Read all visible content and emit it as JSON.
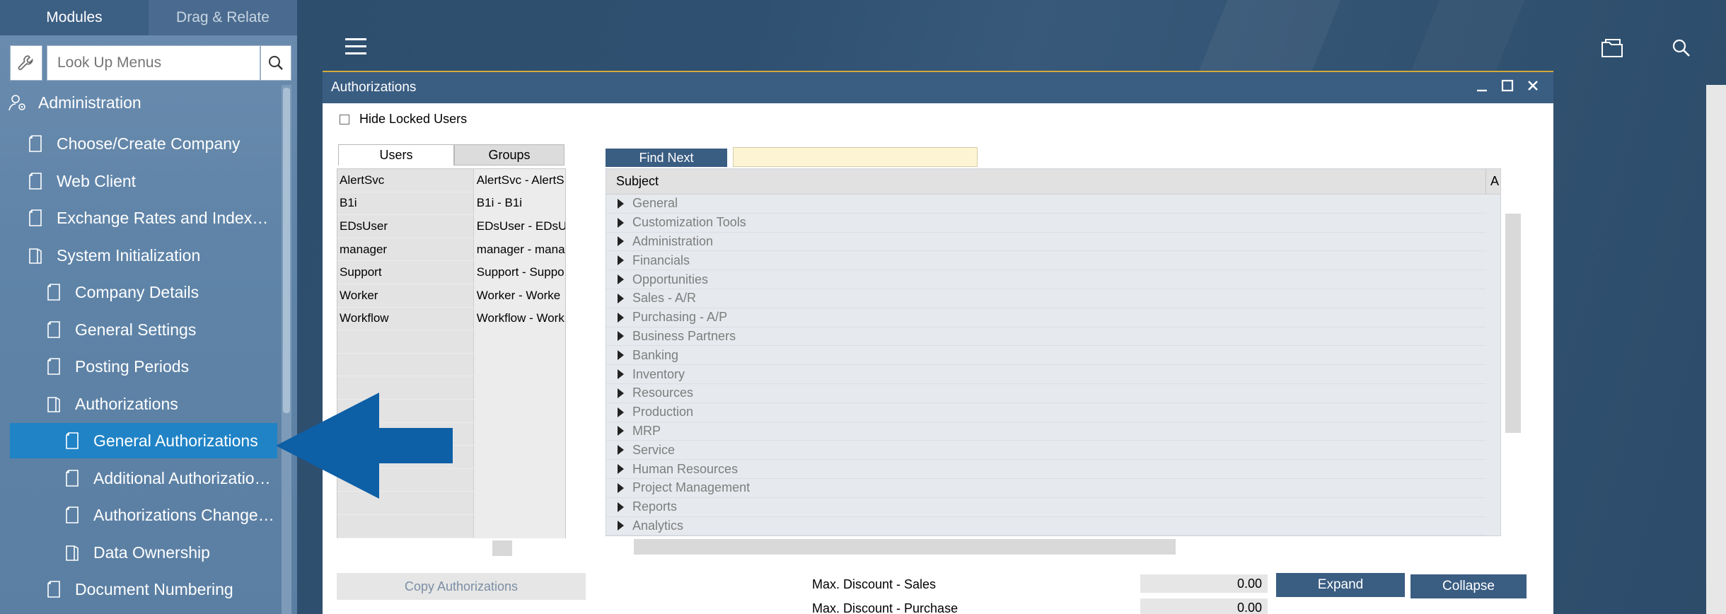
{
  "sidebar": {
    "tabs": {
      "modules": "Modules",
      "drag_relate": "Drag & Relate"
    },
    "lookup": {
      "placeholder": "Look Up Menus"
    },
    "items": [
      {
        "label": "Administration"
      },
      {
        "label": "Choose/Create Company"
      },
      {
        "label": "Web Client"
      },
      {
        "label": "Exchange Rates and Index…"
      },
      {
        "label": "System Initialization"
      },
      {
        "label": "Company Details"
      },
      {
        "label": "General Settings"
      },
      {
        "label": "Posting Periods"
      },
      {
        "label": "Authorizations"
      },
      {
        "label": "General Authorizations"
      },
      {
        "label": "Additional Authorizatio…"
      },
      {
        "label": "Authorizations Change…"
      },
      {
        "label": "Data Ownership"
      },
      {
        "label": "Document Numbering"
      }
    ]
  },
  "toolbar": {
    "menu_icon": "hamburger-icon",
    "folder_icon": "folder-icon",
    "search_icon": "search-icon"
  },
  "window": {
    "title": "Authorizations",
    "hide_locked_users": "Hide Locked Users",
    "tabs": {
      "users": "Users",
      "groups": "Groups"
    },
    "users": [
      {
        "code": "AlertSvc",
        "name": "AlertSvc - AlertS"
      },
      {
        "code": "B1i",
        "name": "B1i - B1i"
      },
      {
        "code": "EDsUser",
        "name": "EDsUser - EDsU"
      },
      {
        "code": "manager",
        "name": "manager - mana"
      },
      {
        "code": "Support",
        "name": "Support - Suppo"
      },
      {
        "code": "Worker",
        "name": "Worker - Worke"
      },
      {
        "code": "Workflow",
        "name": "Workflow - Work"
      }
    ],
    "find_next": "Find Next",
    "subject_header": "Subject",
    "second_header": "A",
    "subjects": [
      "General",
      "Customization Tools",
      "Administration",
      "Financials",
      "Opportunities",
      "Sales - A/R",
      "Purchasing - A/P",
      "Business Partners",
      "Banking",
      "Inventory",
      "Resources",
      "Production",
      "MRP",
      "Service",
      "Human Resources",
      "Project Management",
      "Reports",
      "Analytics"
    ],
    "copy_authorizations": "Copy Authorizations",
    "max_discount_sales_label": "Max. Discount - Sales",
    "max_discount_sales_value": "0.00",
    "max_discount_purchase_label": "Max. Discount - Purchase",
    "max_discount_purchase_value": "0.00",
    "expand": "Expand",
    "collapse": "Collapse"
  },
  "colors": {
    "sidebar_selected": "#2083c6",
    "arrow": "#0d5fa6",
    "window_header": "#3a5d82"
  }
}
